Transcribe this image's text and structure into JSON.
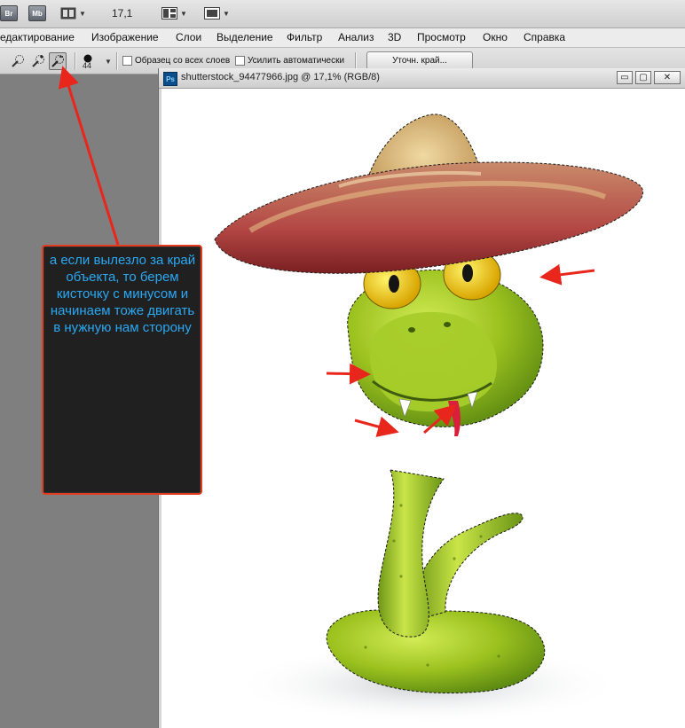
{
  "appbar": {
    "br_badge": "Br",
    "mb_badge": "Mb",
    "zoom": "17,1",
    "icons": [
      "film-strip-icon",
      "layout-icon",
      "screen-mode-icon"
    ]
  },
  "menu": [
    "едактирование",
    "Изображение",
    "Слои",
    "Выделение",
    "Фильтр",
    "Анализ",
    "3D",
    "Просмотр",
    "Окно",
    "Справка"
  ],
  "options": {
    "brush_size": "44",
    "sample_all_layers": "Образец со всех слоев",
    "auto_enhance": "Усилить автоматически",
    "refine_edge": "Уточн. край..."
  },
  "document": {
    "title": "shutterstock_94477966.jpg @ 17,1% (RGB/8)",
    "ps_icon": "Ps",
    "min_label": "▭",
    "max_label": "▢",
    "close_label": "✕"
  },
  "annotation": {
    "text": "а если вылезло за край объекта, то берем кисточку с минусом и начинаем тоже двигать в нужную нам сторону"
  },
  "colors": {
    "arrow_red": "#e8261c",
    "note_text": "#2aa8f3",
    "note_border": "#e23b1d",
    "snake_green": "#9cc21f",
    "hat_straw": "#c9a56b",
    "hat_brim_red": "#b84d4a"
  }
}
